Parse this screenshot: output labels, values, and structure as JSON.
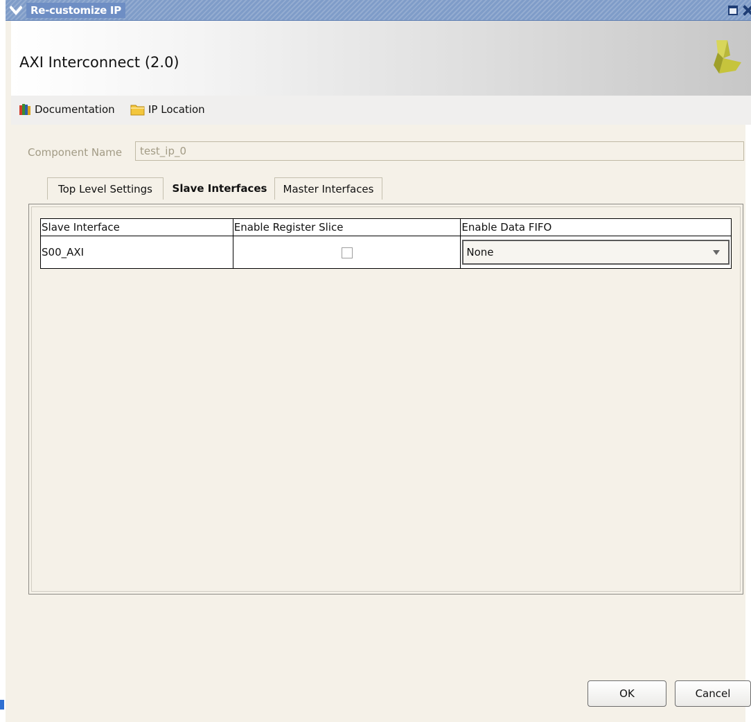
{
  "window": {
    "title": "Re-customize IP",
    "menu_icon": "chevron-down-icon",
    "maximize_icon": "maximize-icon",
    "close_icon": "close-icon"
  },
  "header": {
    "title": "AXI Interconnect (2.0)",
    "logo_icon": "vendor-logo-icon"
  },
  "toolbar": {
    "documentation_label": "Documentation",
    "documentation_icon": "books-icon",
    "ip_location_label": "IP Location",
    "ip_location_icon": "folder-icon"
  },
  "component": {
    "label": "Component Name",
    "value": "test_ip_0"
  },
  "tabs": [
    {
      "label": "Top Level Settings",
      "active": false
    },
    {
      "label": "Slave Interfaces",
      "active": true
    },
    {
      "label": "Master Interfaces",
      "active": false
    }
  ],
  "table": {
    "headers": [
      "Slave Interface",
      "Enable Register Slice",
      "Enable Data FIFO"
    ],
    "rows": [
      {
        "interface": "S00_AXI",
        "register_slice": false,
        "data_fifo": "None"
      }
    ]
  },
  "buttons": {
    "ok": "OK",
    "cancel": "Cancel"
  },
  "colors": {
    "titlebar": "#7f9cc8",
    "window_bg": "#f5f1e8",
    "disabled_text": "#a29b85"
  }
}
